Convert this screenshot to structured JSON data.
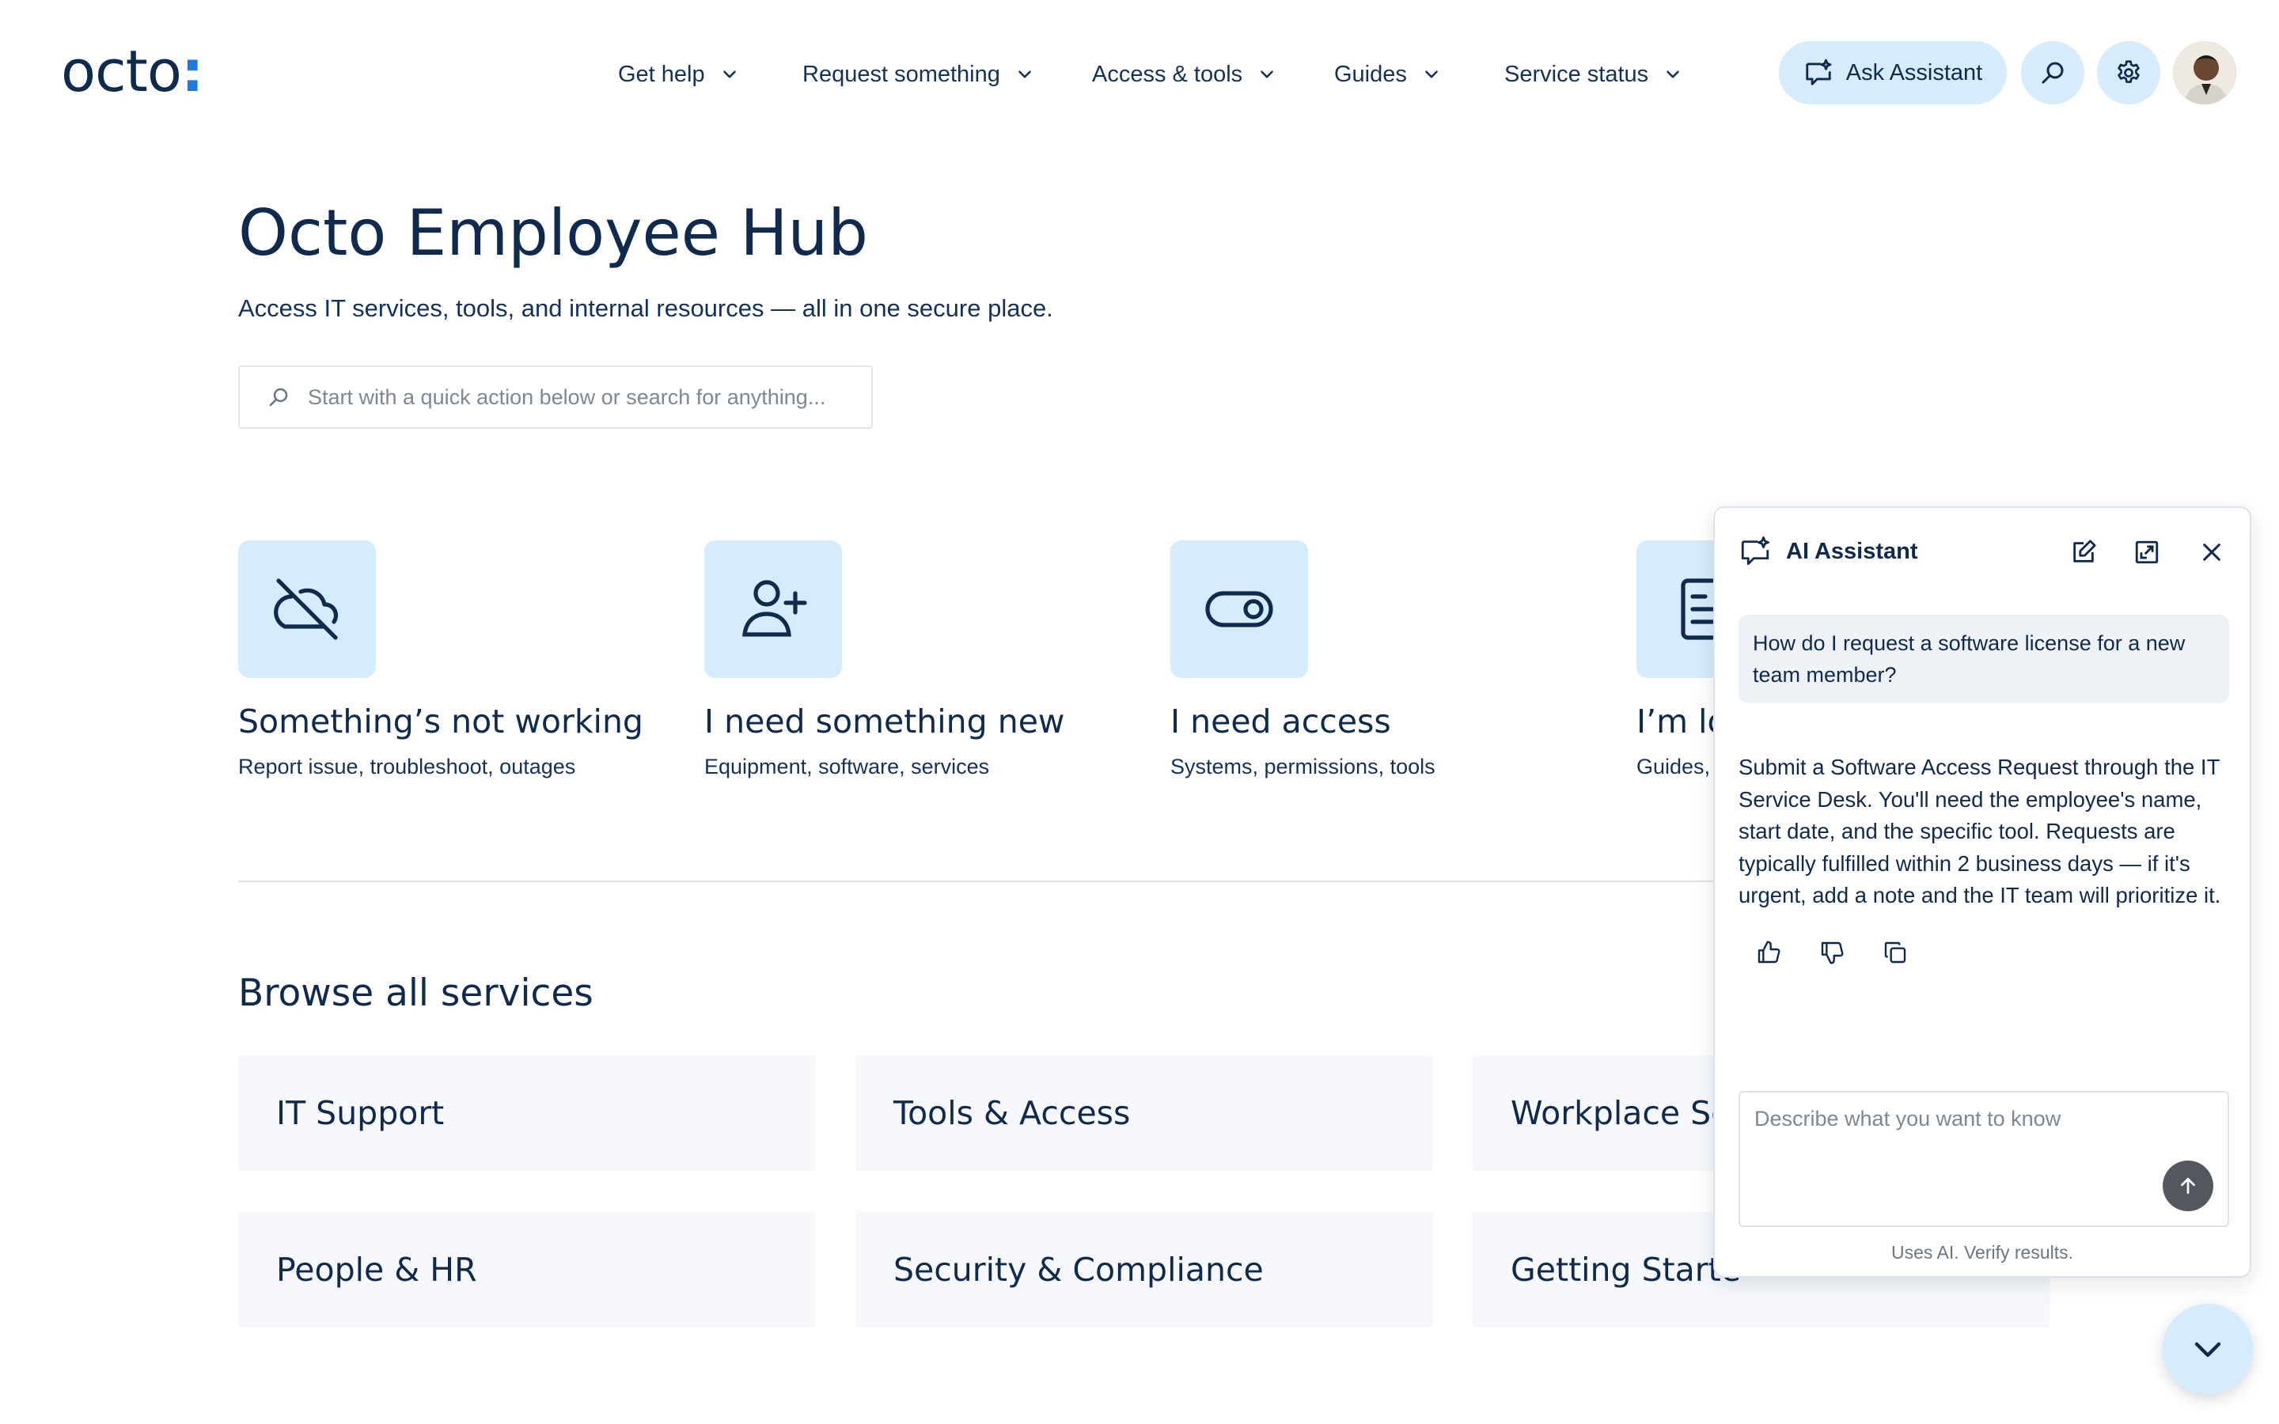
{
  "header": {
    "logo_text": "octo",
    "logo_colon": ":",
    "nav": [
      {
        "label": "Get help"
      },
      {
        "label": "Request something"
      },
      {
        "label": "Access & tools"
      },
      {
        "label": "Guides"
      },
      {
        "label": "Service status"
      }
    ],
    "ask_assistant_label": "Ask Assistant"
  },
  "hero": {
    "title": "Octo Employee Hub",
    "subtitle": "Access IT services, tools, and internal resources — all in one secure place.",
    "search_placeholder": "Start with a quick action below or search for anything..."
  },
  "quick_actions": [
    {
      "title": "Something’s not working",
      "subtitle": "Report issue, troubleshoot, outages",
      "icon": "cloud-off-icon"
    },
    {
      "title": "I need something new",
      "subtitle": "Equipment, software, services",
      "icon": "user-plus-icon"
    },
    {
      "title": "I need access",
      "subtitle": "Systems, permissions, tools",
      "icon": "toggle-icon"
    },
    {
      "title": "I’m lo",
      "subtitle": "Guides,",
      "icon": "document-icon"
    }
  ],
  "browse": {
    "title": "Browse all services",
    "cards": [
      "IT Support",
      "Tools & Access",
      "Workplace Se",
      "People & HR",
      "Security & Compliance",
      "Getting Starte"
    ]
  },
  "assistant": {
    "title": "AI Assistant",
    "user_message": "How do I request a software license for a new team member?",
    "reply": "Submit a Software Access Request through the IT Service Desk. You'll need the employee's name, start date, and the specific tool. Requests are typically fulfilled within 2 business days — if it's urgent, add a note and the IT team will prioritize it.",
    "input_placeholder": "Describe what you want to know",
    "disclaimer": "Uses AI. Verify results."
  },
  "colors": {
    "accent": "#1f7ae0",
    "tile_bg": "#d6ebfb",
    "text": "#0f2a4d"
  }
}
